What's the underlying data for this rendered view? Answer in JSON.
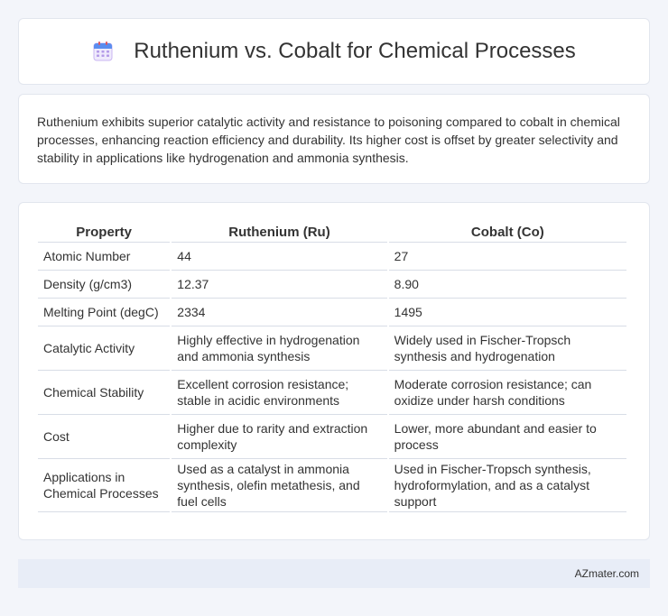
{
  "header": {
    "icon": "calendar-icon",
    "title": "Ruthenium vs. Cobalt for Chemical Processes"
  },
  "summary": "Ruthenium exhibits superior catalytic activity and resistance to poisoning compared to cobalt in chemical processes, enhancing reaction efficiency and durability. Its higher cost is offset by greater selectivity and stability in applications like hydrogenation and ammonia synthesis.",
  "table": {
    "headers": [
      "Property",
      "Ruthenium (Ru)",
      "Cobalt (Co)"
    ],
    "rows": [
      [
        "Atomic Number",
        "44",
        "27"
      ],
      [
        "Density (g/cm3)",
        "12.37",
        "8.90"
      ],
      [
        "Melting Point (degC)",
        "2334",
        "1495"
      ],
      [
        "Catalytic Activity",
        "Highly effective in hydrogenation and ammonia synthesis",
        "Widely used in Fischer-Tropsch synthesis and hydrogenation"
      ],
      [
        "Chemical Stability",
        "Excellent corrosion resistance; stable in acidic environments",
        "Moderate corrosion resistance; can oxidize under harsh conditions"
      ],
      [
        "Cost",
        "Higher due to rarity and extraction complexity",
        "Lower, more abundant and easier to process"
      ],
      [
        "Applications in Chemical Processes",
        "Used as a catalyst in ammonia synthesis, olefin metathesis, and fuel cells",
        "Used in Fischer-Tropsch synthesis, hydroformylation, and as a catalyst support"
      ]
    ]
  },
  "footer": {
    "brand": "AZmater.com"
  },
  "colors": {
    "background": "#f3f5fa",
    "card": "#ffffff",
    "footer": "#e8edf7",
    "icon_header": "#5b8def",
    "icon_body": "#c9b6f2"
  }
}
